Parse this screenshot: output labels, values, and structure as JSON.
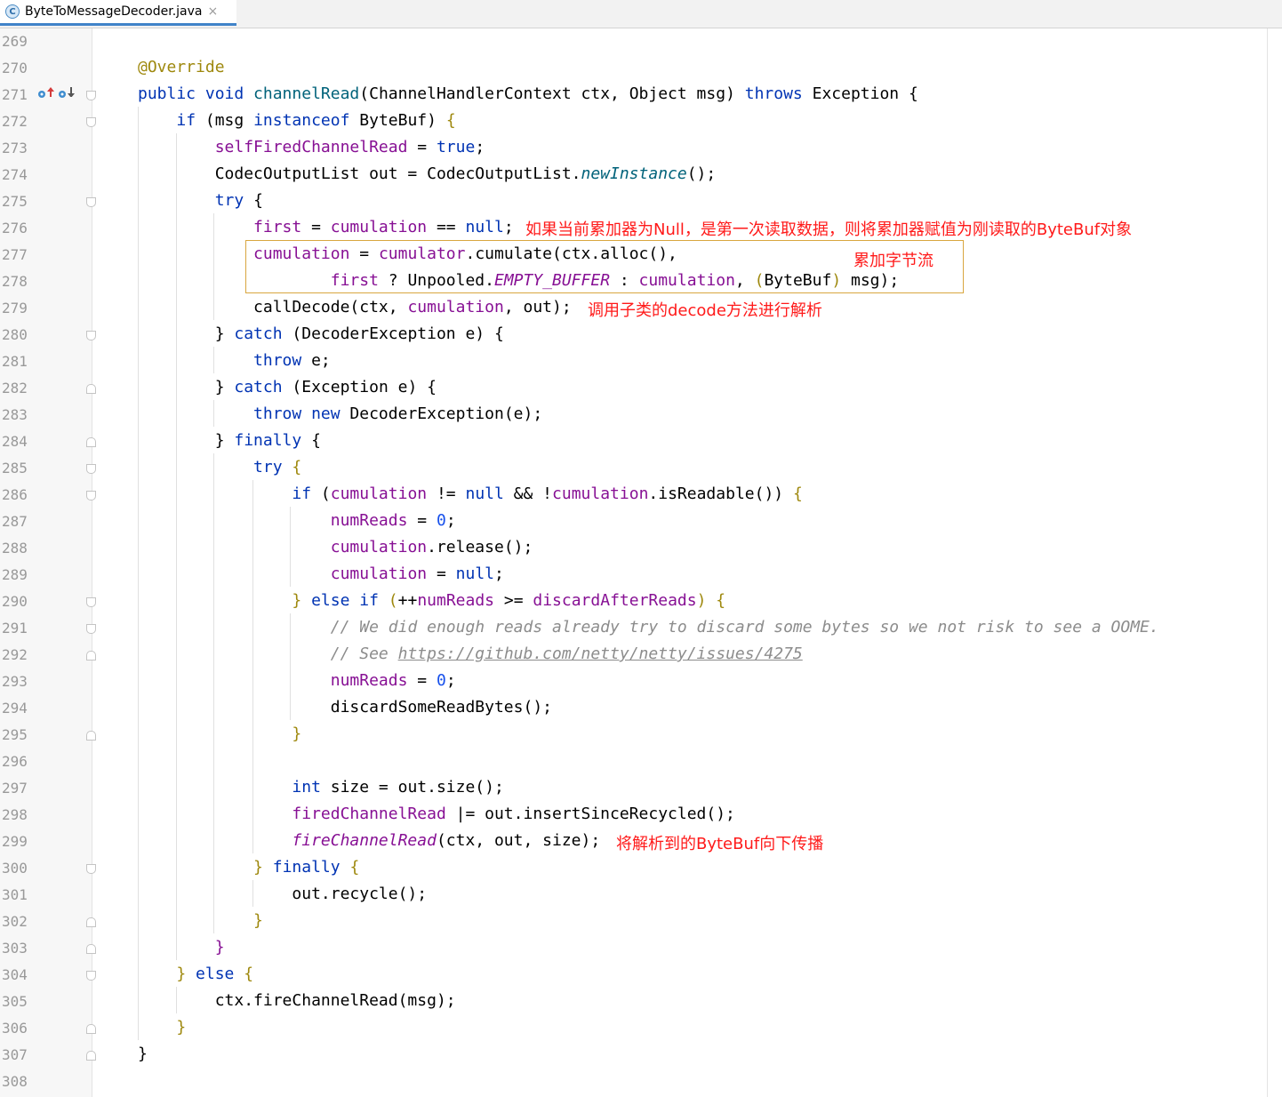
{
  "tab": {
    "filename": "ByteToMessageDecoder.java",
    "icon": "java-class-icon",
    "close": "×"
  },
  "lines": [
    {
      "num": "269",
      "fold": ""
    },
    {
      "num": "270",
      "fold": ""
    },
    {
      "num": "271",
      "fold": "open"
    },
    {
      "num": "272",
      "fold": "open"
    },
    {
      "num": "273",
      "fold": ""
    },
    {
      "num": "274",
      "fold": ""
    },
    {
      "num": "275",
      "fold": "open"
    },
    {
      "num": "276",
      "fold": ""
    },
    {
      "num": "277",
      "fold": ""
    },
    {
      "num": "278",
      "fold": ""
    },
    {
      "num": "279",
      "fold": ""
    },
    {
      "num": "280",
      "fold": "open"
    },
    {
      "num": "281",
      "fold": ""
    },
    {
      "num": "282",
      "fold": "close"
    },
    {
      "num": "283",
      "fold": ""
    },
    {
      "num": "284",
      "fold": "close"
    },
    {
      "num": "285",
      "fold": "open"
    },
    {
      "num": "286",
      "fold": "open"
    },
    {
      "num": "287",
      "fold": ""
    },
    {
      "num": "288",
      "fold": ""
    },
    {
      "num": "289",
      "fold": ""
    },
    {
      "num": "290",
      "fold": "open"
    },
    {
      "num": "291",
      "fold": "open"
    },
    {
      "num": "292",
      "fold": "close"
    },
    {
      "num": "293",
      "fold": ""
    },
    {
      "num": "294",
      "fold": ""
    },
    {
      "num": "295",
      "fold": "close"
    },
    {
      "num": "296",
      "fold": ""
    },
    {
      "num": "297",
      "fold": ""
    },
    {
      "num": "298",
      "fold": ""
    },
    {
      "num": "299",
      "fold": ""
    },
    {
      "num": "300",
      "fold": "open"
    },
    {
      "num": "301",
      "fold": ""
    },
    {
      "num": "302",
      "fold": "close"
    },
    {
      "num": "303",
      "fold": "close"
    },
    {
      "num": "304",
      "fold": "open"
    },
    {
      "num": "305",
      "fold": ""
    },
    {
      "num": "306",
      "fold": "close"
    },
    {
      "num": "307",
      "fold": "close"
    },
    {
      "num": "308",
      "fold": ""
    }
  ],
  "notes": {
    "n276": "如果当前累加器为Null，是第一次读取数据，则将累加器赋值为刚读取的ByteBuf对象",
    "n277": "累加字节流",
    "n279": "调用子类的decode方法进行解析",
    "n299": "将解析到的ByteBuf向下传播"
  },
  "code": {
    "l270": "@Override",
    "l291": "// We did enough reads already try to discard some bytes so we not risk to see a OOME.",
    "l292_pre": "// See ",
    "l292_link": "https://github.com/netty/netty/issues/4275"
  },
  "gutter_icons": [
    "override-up-icon",
    "implemented-down-icon"
  ]
}
